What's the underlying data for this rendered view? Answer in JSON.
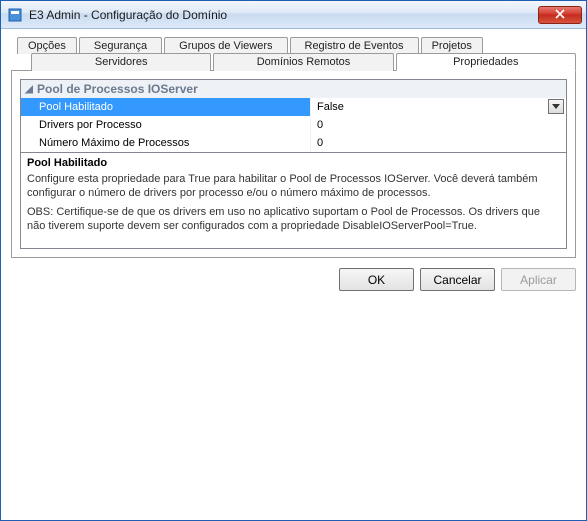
{
  "window": {
    "title": "E3 Admin - Configuração do Domínio"
  },
  "tabs": {
    "row1": [
      {
        "label": "Opções"
      },
      {
        "label": "Segurança"
      },
      {
        "label": "Grupos de Viewers"
      },
      {
        "label": "Registro de Eventos"
      },
      {
        "label": "Projetos"
      }
    ],
    "row2": [
      {
        "label": "Servidores"
      },
      {
        "label": "Domínios Remotos"
      },
      {
        "label": "Propriedades",
        "active": true
      }
    ]
  },
  "propgrid": {
    "group_label": "Pool de Processos IOServer",
    "rows": [
      {
        "name": "Pool Habilitado",
        "value": "False",
        "selected": true,
        "has_dropdown": true
      },
      {
        "name": "Drivers por Processo",
        "value": "0"
      },
      {
        "name": "Número Máximo de Processos",
        "value": "0"
      }
    ],
    "description": {
      "title": "Pool Habilitado",
      "p1": "Configure esta propriedade para True para habilitar o Pool de Processos IOServer. Você deverá também configurar o número de drivers por processo e/ou o número máximo de processos.",
      "p2": "OBS: Certifique-se de que os drivers em uso no aplicativo suportam o Pool de Processos. Os drivers que não tiverem suporte devem ser configurados com a propriedade DisableIOServerPool=True."
    }
  },
  "buttons": {
    "ok": "OK",
    "cancel": "Cancelar",
    "apply": "Aplicar"
  }
}
